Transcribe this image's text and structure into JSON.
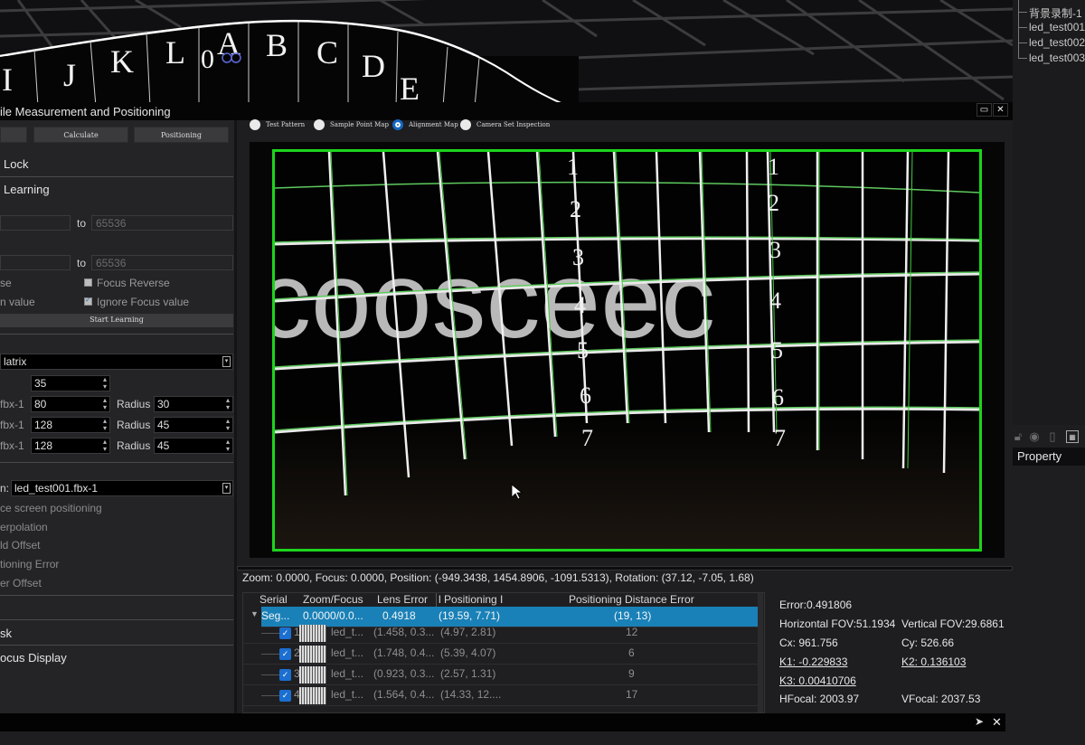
{
  "viewport": {
    "ruler_letters": [
      "I",
      "J",
      "K",
      "L",
      "0A",
      "B",
      "C",
      "D",
      "E",
      "A"
    ],
    "grid_color": "#3a3a3a"
  },
  "scene_tree": {
    "items": [
      "背景录制-1",
      "led_test001",
      "led_test002",
      "led_test003"
    ]
  },
  "property_panel": {
    "tab_label": "Property",
    "icons": [
      "lock-icon",
      "eye-icon",
      "clipboard-icon",
      "calculator-icon"
    ]
  },
  "window": {
    "title": "ile Measurement and Positioning",
    "restore_icon": "▭",
    "close_icon": "✕"
  },
  "left_panel": {
    "toolbar": {
      "button0": "",
      "calculate": "Calculate",
      "positioning": "Positioning"
    },
    "sections": {
      "lock": "Lock",
      "learning": "Learning"
    },
    "range1": {
      "from": "",
      "to_label": "to",
      "to_value": "65536"
    },
    "range2": {
      "from": "",
      "to_label": "to",
      "to_value": "65536"
    },
    "options": {
      "zoom_reverse": "se",
      "focus_reverse": "Focus Reverse",
      "ignore_zoom": "n value",
      "ignore_focus": "Ignore Focus value",
      "focus_reverse_checked": false,
      "ignore_focus_checked": true
    },
    "start_learning": "Start Learning",
    "matrix": {
      "combo_value": "latrix",
      "count_value": "35",
      "rows": [
        {
          "label": "fbx-1",
          "value": "80",
          "radius_label": "Radius",
          "radius": "30"
        },
        {
          "label": "fbx-1",
          "value": "128",
          "radius_label": "Radius",
          "radius": "45"
        },
        {
          "label": "fbx-1",
          "value": "128",
          "radius_label": "Radius",
          "radius": "45"
        }
      ]
    },
    "screen": {
      "label": "n:",
      "combo_value": "led_test001.fbx-1"
    },
    "screen_options": [
      "ce screen positioning",
      "erpolation",
      "ld Offset",
      "tioning Error",
      "er Offset"
    ],
    "bottom_sections": {
      "mask": "sk",
      "focus_display": "ocus Display"
    }
  },
  "view_modes": {
    "options": [
      "Test Pattern",
      "Sample Point Map",
      "Alignment Map",
      "Camera Set Inspection"
    ],
    "selected": "Alignment Map"
  },
  "camera_view": {
    "overlay_text": "coosceec",
    "column_numbers": [
      "1",
      "2",
      "3",
      "4",
      "5",
      "6",
      "7"
    ],
    "frame_color": "#1dd41d"
  },
  "status_line": "Zoom: 0.0000, Focus: 0.0000, Position: (-949.3438, 1454.8906, -1091.5313), Rotation: (37.12, -7.05, 1.68)",
  "table": {
    "columns": [
      "Serial",
      "Zoom/Focus",
      "Lens Error",
      "l Positioning I",
      "Positioning Distance Error"
    ],
    "parent_row": {
      "serial": "Seg...",
      "zoom_focus": "0.0000/0.0...",
      "lens_error": "0.4918",
      "positioning": "(19.59, 7.71)",
      "distance_error": "(19, 13)"
    },
    "rows": [
      {
        "index": "1",
        "name": "led_t...",
        "lens": "(1.458, 0.3...",
        "positioning": "(4.97, 2.81)",
        "distance": "12",
        "checked": true
      },
      {
        "index": "2",
        "name": "led_t...",
        "lens": "(1.748, 0.4...",
        "positioning": "(5.39, 4.07)",
        "distance": "6",
        "checked": true
      },
      {
        "index": "3",
        "name": "led_t...",
        "lens": "(0.923, 0.3...",
        "positioning": "(2.57, 1.31)",
        "distance": "9",
        "checked": true
      },
      {
        "index": "4",
        "name": "led_t...",
        "lens": "(1.564, 0.4...",
        "positioning": "(14.33, 12....",
        "distance": "17",
        "checked": true
      }
    ]
  },
  "results": {
    "error": "Error:0.491806",
    "hfov": "Horizontal FOV:51.1934",
    "vfov": "Vertical FOV:29.6861",
    "cx": "Cx:  961.756",
    "cy": "Cy:  526.66",
    "k1": "K1:  -0.229833",
    "k2": "K2:  0.136103",
    "k3": "K3:  0.00410706",
    "hfocal": "HFocal:  2003.97",
    "vfocal": "VFocal:  2037.53"
  },
  "command_bar": {
    "send_icon": "➤",
    "close_icon": "✕"
  }
}
